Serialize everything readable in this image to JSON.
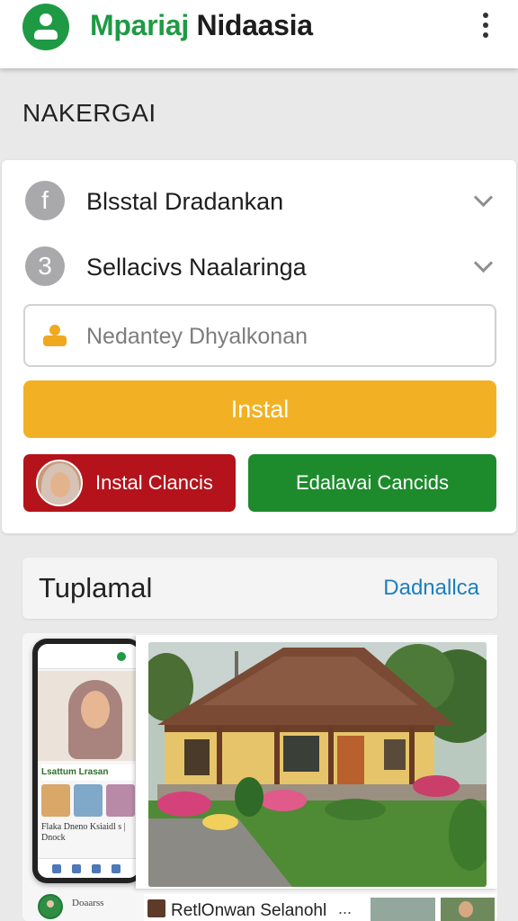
{
  "header": {
    "title_part1": "Mpariaj",
    "title_part2": "Nidaasia",
    "avatar_icon": "account-circle-icon",
    "menu_icon": "more-vert-icon"
  },
  "section": {
    "heading": "NAKERGAI"
  },
  "form": {
    "rows": [
      {
        "badge": "f",
        "label": "Blsstal Dradankan"
      },
      {
        "badge": "3",
        "label": "Sellacivs Naalaringa"
      }
    ],
    "input": {
      "placeholder": "Nedantey Dhyalkonan"
    },
    "install_button": "Instal",
    "red_button": "Instal Clancis",
    "green_button": "Edalavai Cancids"
  },
  "gallery": {
    "title": "Tuplamal",
    "link": "Dadnallca",
    "phone": {
      "strip_text": "Lsattum Lrasan",
      "caption": "Flaka Dneno Ksiaidl s | Dnock"
    },
    "bottom_left_text": "Doaarss",
    "bottom_right_text": "RetlOnwan Selanohl",
    "bottom_right_more": "..."
  },
  "colors": {
    "brand_green": "#1f9a44",
    "accent_orange": "#f2b124",
    "danger_red": "#b5131b",
    "action_green": "#1d8b2c",
    "link_blue": "#1c7fc1"
  }
}
